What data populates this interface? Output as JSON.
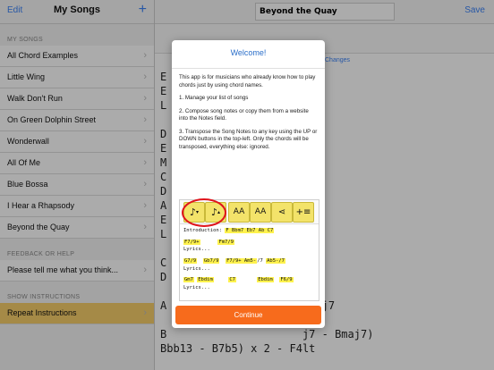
{
  "sidebar": {
    "edit": "Edit",
    "title": "My Songs",
    "plus": "+",
    "sec1": "MY SONGS",
    "songs": [
      "All Chord Examples",
      "Little Wing",
      "Walk Don't Run",
      "On Green Dolphin Street",
      "Wonderwall",
      "All Of Me",
      "Blue Bossa",
      "I Hear a Rhapsody",
      "Beyond the Quay"
    ],
    "sec2": "FEEDBACK OR HELP",
    "feedback": "Please tell me what you think...",
    "sec3": "SHOW INSTRUCTIONS",
    "instructions": "Repeat Instructions"
  },
  "main": {
    "song_title": "Beyond the Quay",
    "save": "Save",
    "changes": "Changes",
    "notes": [
      "E",
      "E",
      "L",
      "",
      "D",
      "E",
      "M",
      "C",
      "D",
      "A",
      "E",
      "L",
      "",
      "C",
      "D",
      "",
      "A                     bmaj7",
      "",
      "B                     j7 - Bmaj7)",
      "Bbb13 - B7b5) x 2 - F4lt"
    ],
    "notes_right": [
      "",
      "",
      "",
      "",
      "7",
      "",
      "",
      "",
      "",
      "",
      "",
      "",
      "",
      "",
      "",
      "",
      "",
      "",
      "",
      ""
    ]
  },
  "dialog": {
    "title": "Welcome!",
    "intro": "This app is for musicians who already know how to play chords just by using chord names.",
    "step1": "1. Manage your list of songs",
    "step2": "2. Compose song notes or copy them from a website into the Notes field.",
    "step3": "3. Transpose the Song Notes to any key using the UP or DOWN buttons in the top-left. Only the chords will be transposed, everything else: ignored.",
    "continue": "Continue",
    "preview": {
      "line1_label": "Introduction:",
      "line1_chords": "F Bbm7 Eb7  Ab  C7",
      "line2_c1": "F7/9+",
      "line2_c2": "Fm7/9",
      "lyrics": "Lyrics...",
      "line3": [
        "G7/9",
        "Gb7/9",
        "F7/9+ Am5-",
        "/7",
        "Ab5-/7"
      ],
      "line4": [
        "Gm7",
        "Ebdim",
        "C7",
        "Ebdim",
        "F6/9"
      ]
    }
  },
  "colors": {
    "accent": "#3b82f6",
    "continue": "#f76b1c",
    "chord_highlight": "#fff24d",
    "selected_row": "#f6ce6a",
    "ring": "#e0141c"
  }
}
